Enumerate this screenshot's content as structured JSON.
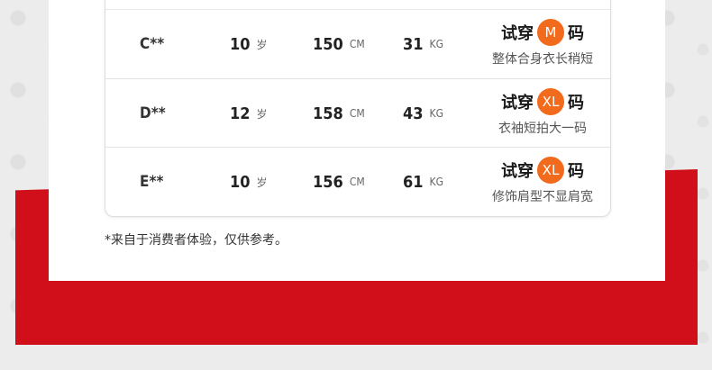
{
  "rows": [
    {
      "name": "C**",
      "age": "10",
      "age_unit": "岁",
      "height": "150",
      "height_unit": "CM",
      "weight": "31",
      "weight_unit": "KG",
      "fit_prefix": "试穿",
      "size": "M",
      "fit_suffix": "码",
      "note": "整体合身衣长稍短"
    },
    {
      "name": "D**",
      "age": "12",
      "age_unit": "岁",
      "height": "158",
      "height_unit": "CM",
      "weight": "43",
      "weight_unit": "KG",
      "fit_prefix": "试穿",
      "size": "XL",
      "fit_suffix": "码",
      "note": "衣袖短拍大一码"
    },
    {
      "name": "E**",
      "age": "10",
      "age_unit": "岁",
      "height": "156",
      "height_unit": "CM",
      "weight": "61",
      "weight_unit": "KG",
      "fit_prefix": "试穿",
      "size": "XL",
      "fit_suffix": "码",
      "note": "修饰肩型不显肩宽"
    }
  ],
  "footnote": "*来自于消费者体验，仅供参考。",
  "colors": {
    "accent_red": "#d10f1a",
    "size_badge": "#f26a1b"
  }
}
